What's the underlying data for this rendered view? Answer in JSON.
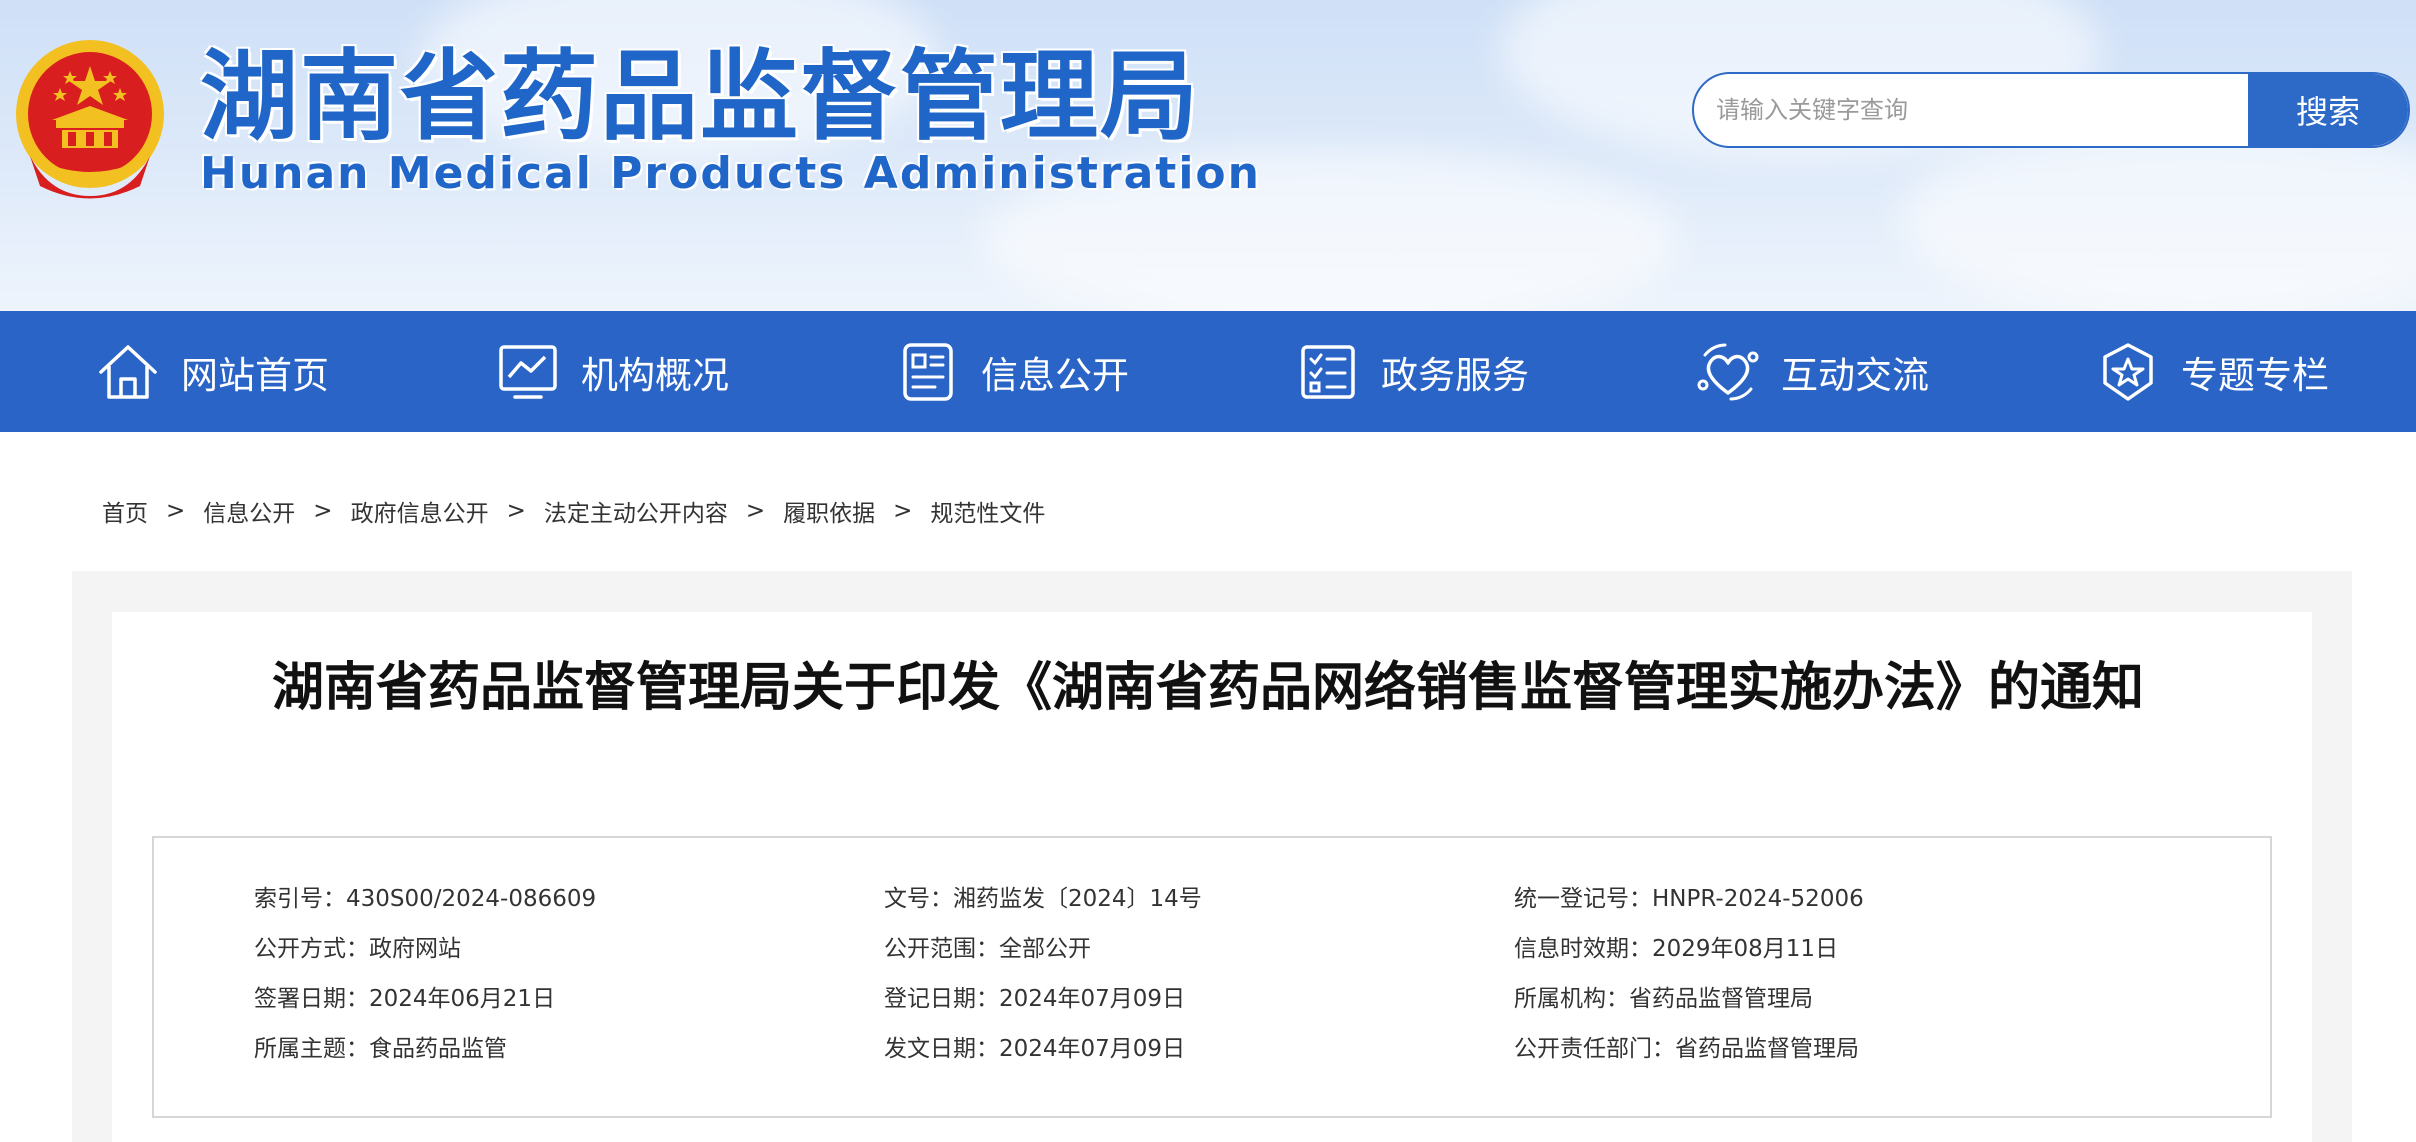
{
  "header": {
    "title_cn": "湖南省药品监督管理局",
    "title_en": "Hunan Medical Products Administration",
    "emblem_icon": "national-emblem-icon",
    "search": {
      "placeholder": "请输入关键字查询",
      "button_label": "搜索"
    }
  },
  "nav": {
    "items": [
      {
        "label": "网站首页",
        "icon": "home-icon"
      },
      {
        "label": "机构概况",
        "icon": "chart-monitor-icon"
      },
      {
        "label": "信息公开",
        "icon": "document-list-icon"
      },
      {
        "label": "政务服务",
        "icon": "checklist-icon"
      },
      {
        "label": "互动交流",
        "icon": "heart-chat-icon"
      },
      {
        "label": "专题专栏",
        "icon": "star-badge-icon"
      }
    ]
  },
  "breadcrumb": {
    "separator": ">",
    "items": [
      "首页",
      "信息公开",
      "政府信息公开",
      "法定主动公开内容",
      "履职依据",
      "规范性文件"
    ]
  },
  "article": {
    "title": "湖南省药品监督管理局关于印发《湖南省药品网络销售监督管理实施办法》的通知"
  },
  "meta": {
    "index_no": "索引号：430S00/2024-086609",
    "doc_no": "文号：湘药监发〔2024〕14号",
    "reg_no": "统一登记号：HNPR-2024-52006",
    "publish_method": "公开方式：政府网站",
    "publish_scope": "公开范围：全部公开",
    "validity": "信息时效期：2029年08月11日",
    "sign_date": "签署日期：2024年06月21日",
    "register_date": "登记日期：2024年07月09日",
    "org": "所属机构：省药品监督管理局",
    "topic": "所属主题：食品药品监管",
    "issue_date": "发文日期：2024年07月09日",
    "dept": "公开责任部门：省药品监督管理局"
  },
  "colors": {
    "brand_blue": "#2a64c6",
    "title_blue": "#1f66c8",
    "emblem_red": "#d81e1e",
    "emblem_gold": "#f3c022"
  }
}
